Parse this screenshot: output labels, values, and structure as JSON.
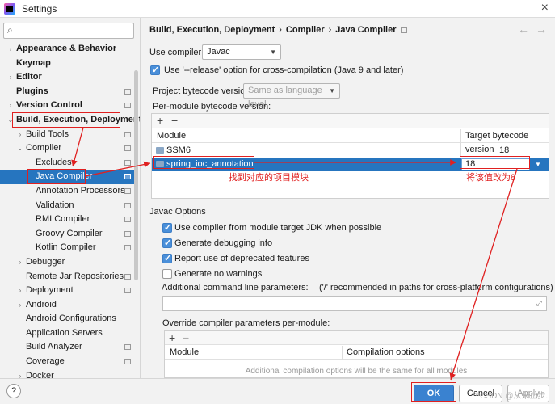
{
  "window": {
    "title": "Settings"
  },
  "search": {
    "placeholder": "",
    "value": ""
  },
  "sidebar": {
    "items": [
      {
        "label": "Appearance & Behavior",
        "arrow": "›",
        "bold": true,
        "badge": false
      },
      {
        "label": "Keymap",
        "arrow": "",
        "bold": true,
        "badge": false
      },
      {
        "label": "Editor",
        "arrow": "›",
        "bold": true,
        "badge": false
      },
      {
        "label": "Plugins",
        "arrow": "",
        "bold": true,
        "badge": true
      },
      {
        "label": "Version Control",
        "arrow": "›",
        "bold": true,
        "badge": true
      },
      {
        "label": "Build, Execution, Deployment",
        "arrow": "⌄",
        "bold": true,
        "badge": false
      },
      {
        "label": "Build Tools",
        "arrow": "›",
        "bold": false,
        "badge": true
      },
      {
        "label": "Compiler",
        "arrow": "⌄",
        "bold": false,
        "badge": true
      },
      {
        "label": "Excludes",
        "arrow": "",
        "bold": false,
        "badge": true
      },
      {
        "label": "Java Compiler",
        "arrow": "",
        "bold": false,
        "badge": true
      },
      {
        "label": "Annotation Processors",
        "arrow": "",
        "bold": false,
        "badge": true
      },
      {
        "label": "Validation",
        "arrow": "",
        "bold": false,
        "badge": true
      },
      {
        "label": "RMI Compiler",
        "arrow": "",
        "bold": false,
        "badge": true
      },
      {
        "label": "Groovy Compiler",
        "arrow": "",
        "bold": false,
        "badge": true
      },
      {
        "label": "Kotlin Compiler",
        "arrow": "",
        "bold": false,
        "badge": true
      },
      {
        "label": "Debugger",
        "arrow": "›",
        "bold": false,
        "badge": false
      },
      {
        "label": "Remote Jar Repositories",
        "arrow": "",
        "bold": false,
        "badge": true
      },
      {
        "label": "Deployment",
        "arrow": "›",
        "bold": false,
        "badge": true
      },
      {
        "label": "Android",
        "arrow": "›",
        "bold": false,
        "badge": false
      },
      {
        "label": "Android Configurations",
        "arrow": "",
        "bold": false,
        "badge": false
      },
      {
        "label": "Application Servers",
        "arrow": "",
        "bold": false,
        "badge": false
      },
      {
        "label": "Build Analyzer",
        "arrow": "",
        "bold": false,
        "badge": true
      },
      {
        "label": "Coverage",
        "arrow": "",
        "bold": false,
        "badge": true
      },
      {
        "label": "Docker",
        "arrow": "›",
        "bold": false,
        "badge": false
      }
    ]
  },
  "breadcrumb": {
    "part1": "Build, Execution, Deployment",
    "sep1": "›",
    "part2": "Compiler",
    "sep2": "›",
    "part3": "Java Compiler"
  },
  "nav": {
    "back": "←",
    "forward": "→"
  },
  "compiler": {
    "use_compiler_label": "Use compiler:",
    "use_compiler_value": "Javac",
    "release_option_label": "Use '--release' option for cross-compilation (Java 9 and later)",
    "release_option_checked": true,
    "project_bytecode_label": "Project bytecode version:",
    "project_bytecode_value": "Same as language level",
    "per_module_label": "Per-module bytecode version:"
  },
  "module_table": {
    "add": "+",
    "remove": "−",
    "col_module": "Module",
    "col_target": "Target bytecode version",
    "rows": [
      {
        "module": "SSM6",
        "target": "18",
        "selected": false
      },
      {
        "module": "spring_ioc_annotation",
        "target": "18",
        "selected": true
      }
    ]
  },
  "annotations": {
    "find_module": "找到对应的项目模块",
    "change_value": "将该值改为8"
  },
  "javac_options": {
    "title": "Javac Options",
    "options": [
      {
        "label": "Use compiler from module target JDK when possible",
        "checked": true
      },
      {
        "label": "Generate debugging info",
        "checked": true
      },
      {
        "label": "Report use of deprecated features",
        "checked": true
      },
      {
        "label": "Generate no warnings",
        "checked": false
      }
    ],
    "additional_params_label": "Additional command line parameters:",
    "additional_params_hint": "('/' recommended in paths for cross-platform configurations)",
    "override_label": "Override compiler parameters per-module:",
    "override_add": "+",
    "override_remove": "−",
    "col_module": "Module",
    "col_options": "Compilation options",
    "empty_text": "Additional compilation options will be the same for all modules"
  },
  "footer": {
    "help": "?",
    "ok": "OK",
    "cancel": "Cancel",
    "apply": "Apply"
  },
  "watermark": "CSDN @从未止步.."
}
